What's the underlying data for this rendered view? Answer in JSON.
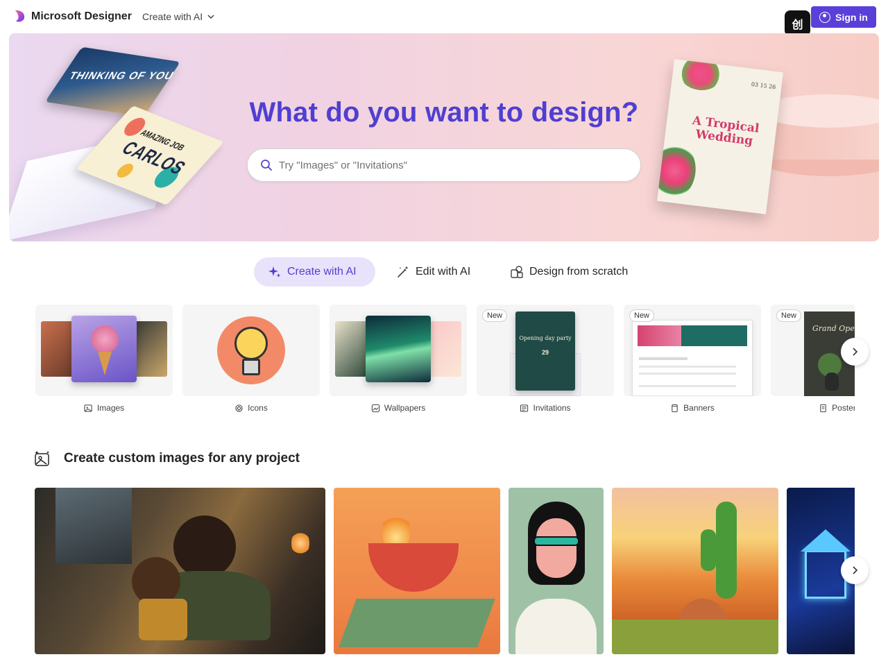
{
  "header": {
    "brand": "Microsoft Designer",
    "create_menu_label": "Create with AI",
    "signin_label": "Sign in",
    "app_badge_text": "创"
  },
  "hero": {
    "title": "What do you want to design?",
    "search_placeholder": "Try \"Images\" or \"Invitations\"",
    "art": {
      "thinking_card_text": "THINKING OF YOU",
      "carlos_card_small": "AMAZING JOB",
      "carlos_card_name": "CARLOS",
      "wedding_title": "A Tropical Wedding",
      "wedding_date": "03 15 26"
    }
  },
  "mode_tabs": [
    {
      "label": "Create with AI",
      "icon": "sparkle-icon",
      "active": true
    },
    {
      "label": "Edit with AI",
      "icon": "magic-wand-icon",
      "active": false
    },
    {
      "label": "Design from scratch",
      "icon": "shapes-icon",
      "active": false
    }
  ],
  "categories": [
    {
      "label": "Images",
      "icon": "image-icon",
      "new": false
    },
    {
      "label": "Icons",
      "icon": "icon-shape-icon",
      "new": false
    },
    {
      "label": "Wallpapers",
      "icon": "wallpaper-icon",
      "new": false
    },
    {
      "label": "Invitations",
      "icon": "invitation-icon",
      "new": true,
      "thumb_text": "Opening day party",
      "thumb_date": "29"
    },
    {
      "label": "Banners",
      "icon": "banner-icon",
      "new": true
    },
    {
      "label": "Posters",
      "icon": "poster-icon",
      "new": true,
      "thumb_text": "Grand Opening"
    }
  ],
  "new_badge_label": "New",
  "section": {
    "title": "Create custom images for any project"
  },
  "colors": {
    "accent": "#4f3fd1",
    "signin_bg": "#5b3fd9",
    "active_tab_bg": "#e9e2fb"
  }
}
